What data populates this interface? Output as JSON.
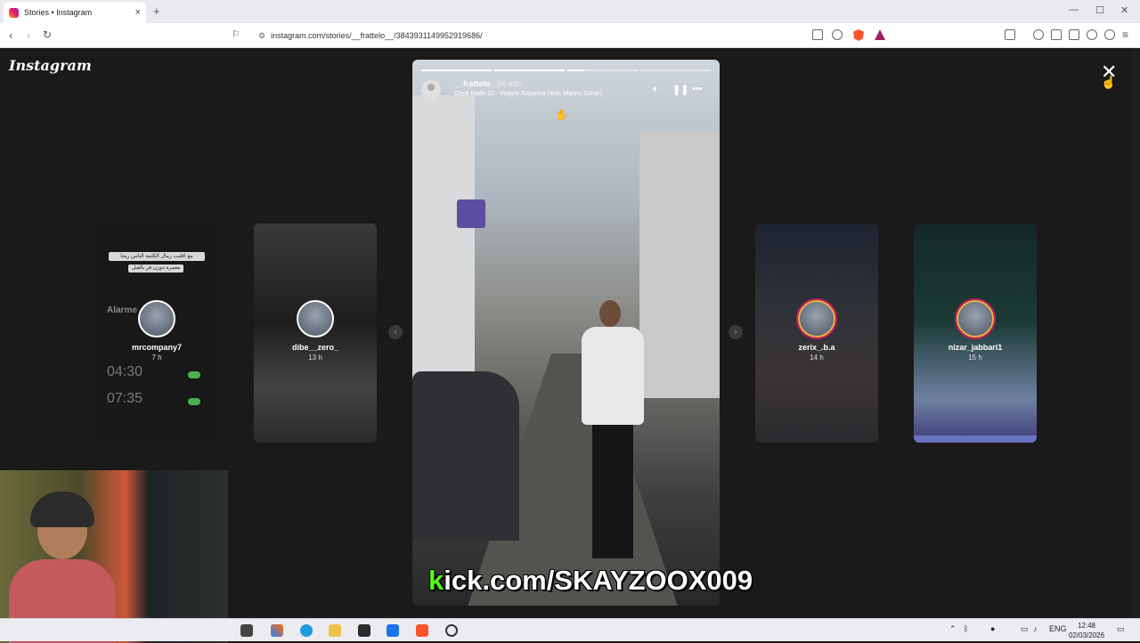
{
  "browser": {
    "tab_title": "Stories • Instagram",
    "new_tab": "+",
    "url": "instagram.com/stories/__frattelo__/3843931149952919686/",
    "window_controls": [
      "—",
      "☐",
      "✕"
    ]
  },
  "instagram": {
    "logo": "Instagram",
    "close_label": "✕"
  },
  "stories": [
    {
      "username": "mrcompany7",
      "time": "7 h"
    },
    {
      "username": "dibe__zero_",
      "time": "13 h"
    },
    {
      "username": "zerix_.b.a",
      "time": "14 h"
    },
    {
      "username": "nizar_jabbari1",
      "time": "15 h"
    }
  ],
  "story_preview_1": {
    "arabic_line1": "مع اقليت رمال الكلمة الناس ريحا",
    "arabic_line2": "معمرة دوزن فر بالقبل",
    "alarm_title": "Alarme",
    "alarms": [
      "04:30",
      "07:35"
    ]
  },
  "current_story": {
    "username": "__frattelo__",
    "time": "56 min",
    "song": "Cheb Nadir 22 - Malgré Tsiparina (feat. Manini Sahar)",
    "progress_segments": [
      1,
      1,
      0.25,
      0
    ],
    "controls": [
      "sound-icon",
      "pause-icon",
      "more-icon"
    ]
  },
  "overlay": {
    "kick_k": "k",
    "kick_rest": "ick.com/SKAYZOOX009"
  },
  "taskbar": {
    "lang": "ENG",
    "time": "12:48",
    "date": "02/03/2026"
  }
}
